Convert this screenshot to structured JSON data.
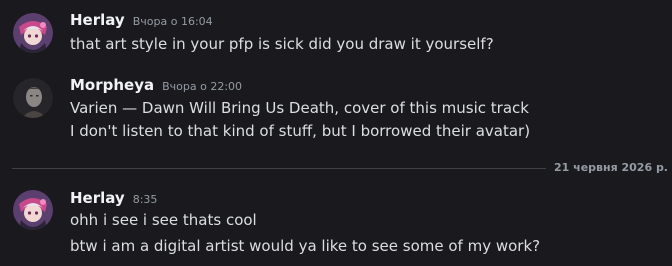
{
  "messages": [
    {
      "author": "Herlay",
      "timestamp": "Вчора о 16:04",
      "lines": [
        "that art style in your pfp is sick did you draw it yourself?"
      ]
    },
    {
      "author": "Morpheya",
      "timestamp": "Вчора о 22:00",
      "lines": [
        "Varien — Dawn Will Bring Us Death, cover of this music track",
        "I don't listen to that kind of stuff, but I borrowed their avatar)"
      ]
    },
    {
      "author": "Herlay",
      "timestamp": "8:35",
      "lines": [
        "ohh i see i see thats cool",
        "btw i am a digital artist would ya like to see some of my work?"
      ]
    }
  ],
  "date_divider": "21 червня 2026 р.",
  "colors": {
    "background": "#1a1a1e",
    "author": "#f2f3f5",
    "text": "#dbdee1",
    "muted": "#949ba4",
    "divider": "#3f4147"
  }
}
